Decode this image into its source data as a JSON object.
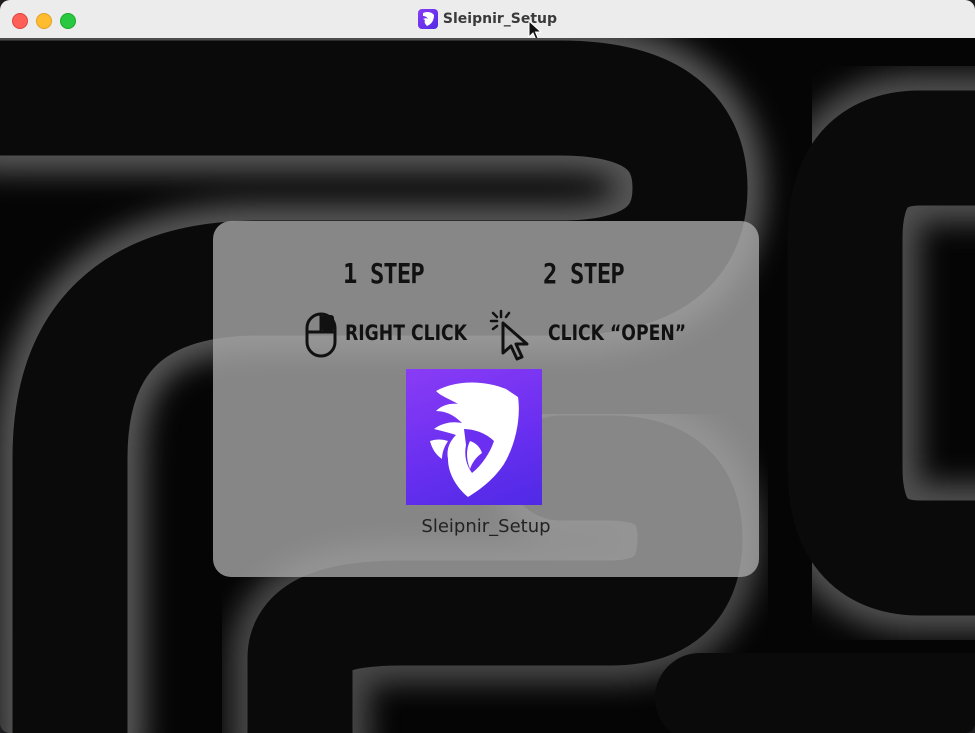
{
  "window": {
    "title": "Sleipnir_Setup"
  },
  "steps": [
    {
      "heading": "1 STEP",
      "action": "RIGHT CLICK",
      "icon": "mouse-icon"
    },
    {
      "heading": "2 STEP",
      "action": "CLICK “OPEN”",
      "icon": "click-pointer-icon"
    }
  ],
  "app": {
    "name": "Sleipnir_Setup",
    "icon": "horse-head-logo-icon"
  },
  "colors": {
    "titlebar": "#ececec",
    "close": "#fe5f57",
    "minimize": "#febc2e",
    "maximize": "#28c840",
    "panel": "#aaaaaa",
    "app_icon_gradient": [
      "#8a3cf5",
      "#4f2ae6"
    ]
  }
}
